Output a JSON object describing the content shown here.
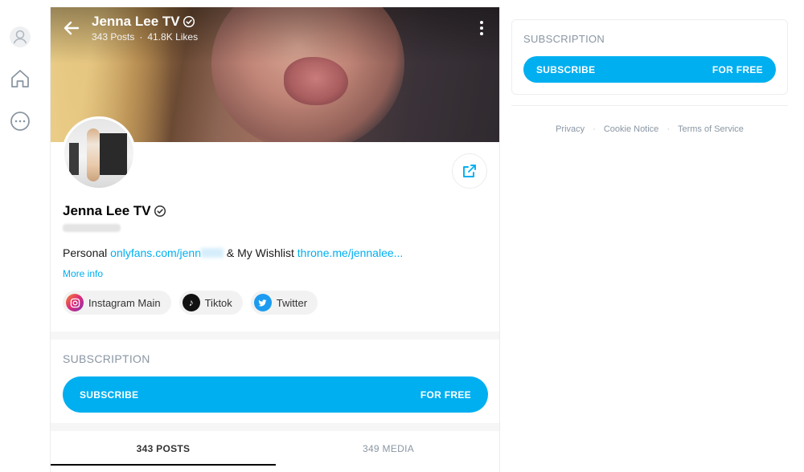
{
  "profile": {
    "name": "Jenna Lee TV",
    "posts_count": "343 Posts",
    "likes_count": "41.8K Likes",
    "stats_separator": "·",
    "bio_prefix": "Personal",
    "bio_link1": "onlyfans.com/jenn",
    "bio_middle": "& My Wishlist",
    "bio_link2": "throne.me/jennalee...",
    "more_info": "More info"
  },
  "social_links": [
    {
      "label": "Instagram Main",
      "icon": "instagram-icon"
    },
    {
      "label": "Tiktok",
      "icon": "tiktok-icon"
    },
    {
      "label": "Twitter",
      "icon": "twitter-icon"
    }
  ],
  "subscription": {
    "label": "SUBSCRIPTION",
    "button_label": "SUBSCRIBE",
    "price": "FOR FREE"
  },
  "tabs": {
    "posts": "343 POSTS",
    "media": "349 MEDIA",
    "active": "posts"
  },
  "sidebar": {
    "label": "SUBSCRIPTION",
    "button_label": "SUBSCRIBE",
    "price": "FOR FREE"
  },
  "footer": {
    "links": [
      "Privacy",
      "Cookie Notice",
      "Terms of Service"
    ],
    "separator": "·"
  },
  "colors": {
    "accent": "#00aff0",
    "muted": "#8a96a3"
  }
}
